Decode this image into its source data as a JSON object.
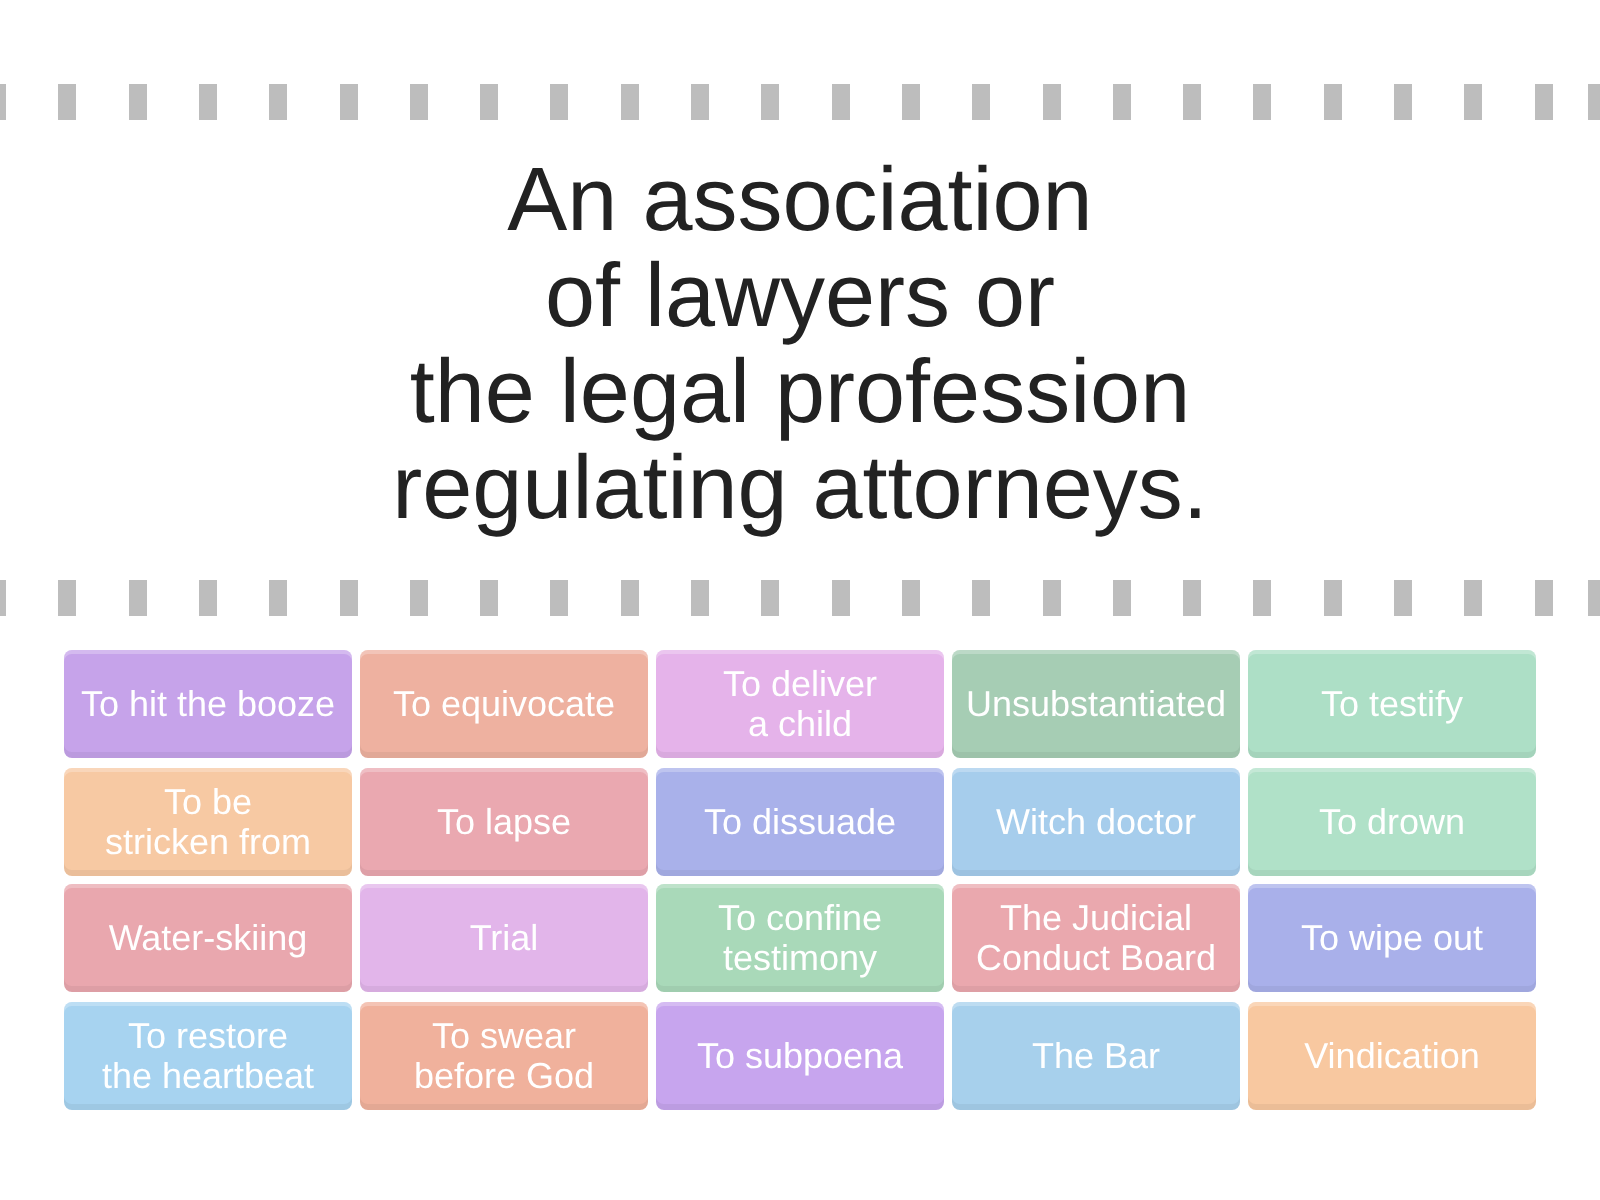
{
  "question": {
    "text": "An association\nof lawyers or\nthe legal profession\nregulating attorneys."
  },
  "tiles": [
    {
      "text": "To hit the booze",
      "color": "#c6a3ea"
    },
    {
      "text": "To equivocate",
      "color": "#eeb1a0"
    },
    {
      "text": "To deliver\na child",
      "color": "#e5b3ea"
    },
    {
      "text": "Unsubstantiated",
      "color": "#a6cdb4"
    },
    {
      "text": "To testify",
      "color": "#addfc6"
    },
    {
      "text": "To be\nstricken from",
      "color": "#f7c9a3"
    },
    {
      "text": "To lapse",
      "color": "#eaa8b0"
    },
    {
      "text": "To dissuade",
      "color": "#a9b1ea"
    },
    {
      "text": "Witch doctor",
      "color": "#a6cdec"
    },
    {
      "text": "To drown",
      "color": "#b0e1c8"
    },
    {
      "text": "Water-skiing",
      "color": "#e9a7ae"
    },
    {
      "text": "Trial",
      "color": "#e2b5ea"
    },
    {
      "text": "To confine\ntestimony",
      "color": "#a9d9b9"
    },
    {
      "text": "The Judicial\nConduct Board",
      "color": "#eaa8ae"
    },
    {
      "text": "To wipe out",
      "color": "#a9b0ea"
    },
    {
      "text": "To restore\nthe heartbeat",
      "color": "#a7d3f0"
    },
    {
      "text": "To swear\nbefore God",
      "color": "#f0b19c"
    },
    {
      "text": "To subpoena",
      "color": "#c7a5ee"
    },
    {
      "text": "The Bar",
      "color": "#a7d0ec"
    },
    {
      "text": "Vindication",
      "color": "#f8c8a0"
    }
  ]
}
